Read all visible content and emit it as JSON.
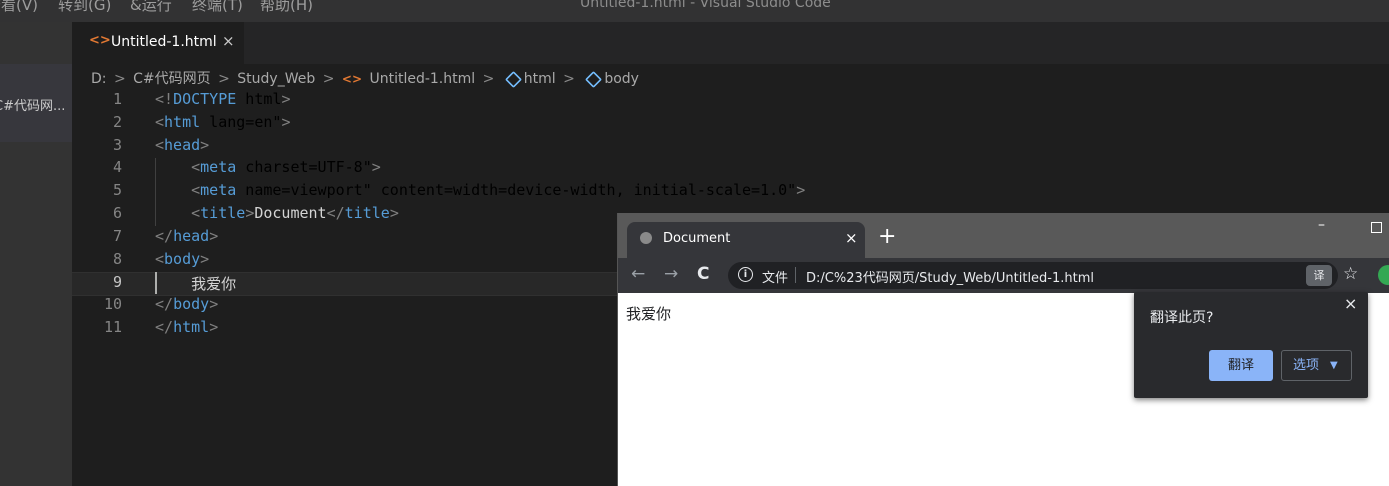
{
  "menubar": {
    "items": [
      "查看(V)",
      "转到(G)",
      "&运行",
      "终端(T)",
      "帮助(H)"
    ],
    "window_title": "Untitled-1.html - Visual Studio Code"
  },
  "explorer": {
    "item_label": "C#代码网..."
  },
  "editor_tab": {
    "label": "Untitled-1.html",
    "close": "×",
    "icon": "html-file-icon"
  },
  "breadcrumb": {
    "items": [
      "D:",
      "C#代码网页",
      "Study_Web",
      "Untitled-1.html",
      "html",
      "body"
    ],
    "separator": ">"
  },
  "code": {
    "line_numbers": [
      "1",
      "2",
      "3",
      "4",
      "5",
      "6",
      "7",
      "8",
      "9",
      "10",
      "11"
    ],
    "lines": [
      "<!DOCTYPE html>",
      "<html lang=\"en\">",
      "<head>",
      "    <meta charset=\"UTF-8\">",
      "    <meta name=\"viewport\" content=\"width=device-width, initial-scale=1.0\">",
      "    <title>Document</title>",
      "</head>",
      "<body>",
      "    我爱你",
      "</body>",
      "</html>"
    ],
    "current_line": 9
  },
  "browser": {
    "tab_title": "Document",
    "tab_close": "×",
    "new_tab": "+",
    "window_min": "–",
    "nav": {
      "back": "←",
      "forward": "→",
      "reload": "C"
    },
    "omnibox": {
      "security_label": "文件",
      "url": "D:/C%23代码网页/Study_Web/Untitled-1.html",
      "info_glyph": "i",
      "translate_glyph": "译"
    },
    "bookmark_star": "☆",
    "page_content": "我爱你",
    "translate_popup": {
      "title": "翻译此页?",
      "close": "×",
      "translate_button": "翻译",
      "options_button": "选项",
      "options_caret": "▼"
    }
  }
}
